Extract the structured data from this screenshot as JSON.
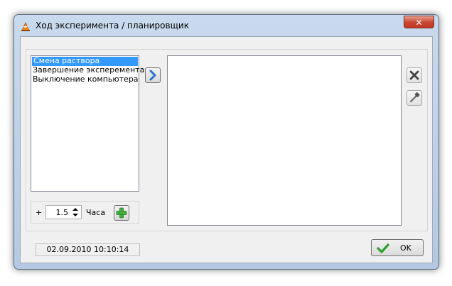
{
  "window": {
    "title": "Ход эксперимента / планировщик",
    "close_glyph": "✕"
  },
  "events": {
    "items": [
      {
        "label": "Смена раствора",
        "selected": true
      },
      {
        "label": "Завершение эксперемента",
        "selected": false
      },
      {
        "label": "Выключение компьютера",
        "selected": false
      }
    ]
  },
  "add_panel": {
    "prefix": "+",
    "hours_value": "1.5",
    "units": "Часа"
  },
  "status": {
    "datetime": "02.09.2010 10:10:14"
  },
  "footer": {
    "ok_label": "OK"
  },
  "colors": {
    "selection": "#3399ff",
    "accent_arrow": "#2a6fd0",
    "add_green": "#3fb03f",
    "ok_check": "#2e9e2e"
  },
  "icons": {
    "app": "cone-icon",
    "transfer": "chevron-right-icon",
    "add": "plus-icon",
    "delete": "close-x-icon",
    "edit": "pipette-icon",
    "ok": "checkmark-icon"
  }
}
